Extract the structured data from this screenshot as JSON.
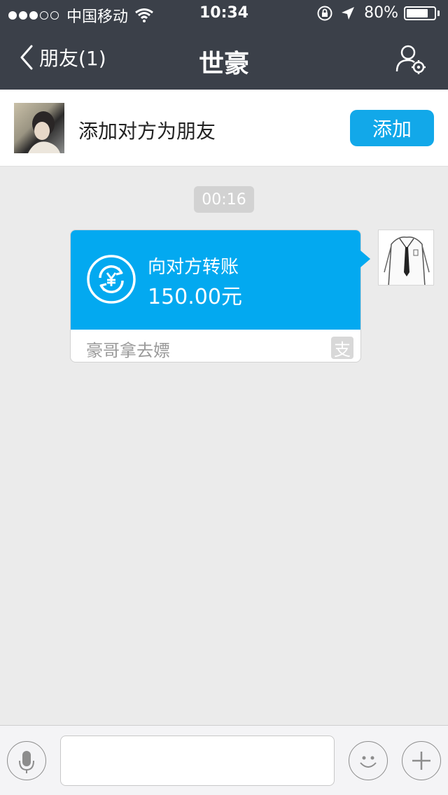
{
  "status_bar": {
    "carrier": "中国移动",
    "time": "10:34",
    "battery_text": "80%",
    "battery_level": 0.8,
    "signal_bars_filled": 3,
    "signal_bars_total": 5
  },
  "nav": {
    "back_label": "朋友(1)",
    "title": "世豪",
    "profile_icon": "user-settings-icon"
  },
  "add_friend_bar": {
    "prompt": "添加对方为朋友",
    "button_label": "添加"
  },
  "chat": {
    "timestamp": "00:16",
    "transfer_message": {
      "title": "向对方转账",
      "amount": "150.00元",
      "note": "豪哥拿去嫖",
      "badge": "支",
      "icon": "yuan-transfer-icon"
    }
  },
  "input_bar": {
    "text_value": "",
    "voice_icon": "microphone-icon",
    "emoji_icon": "smiley-icon",
    "plus_icon": "plus-icon"
  },
  "colors": {
    "header_bg": "#3b4049",
    "accent_blue": "#12a8e9",
    "transfer_blue": "#03a9f0",
    "chat_bg": "#ebebeb"
  }
}
